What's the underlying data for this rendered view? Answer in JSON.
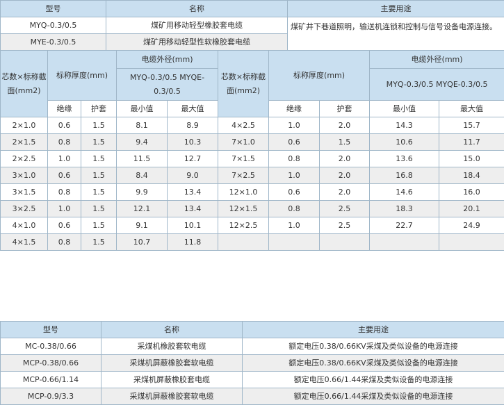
{
  "table1": {
    "headers": [
      "型号",
      "名称",
      "主要用途"
    ],
    "rows": [
      {
        "model": "MYQ-0.3/0.5",
        "name": "煤矿用移动轻型橡胶套电缆"
      },
      {
        "model": "MYE-0.3/0.5",
        "name": "煤矿用移动轻型性软橡胶套电缆"
      }
    ],
    "usage": "煤矿井下巷道照明，输送机连锁和控制与信号设备电源连接。"
  },
  "table2": {
    "h_core": "芯数×标称截面(mm2)",
    "h_core_b": "芯数×标称截面(mm2)",
    "h_thick": "标称厚度(mm)",
    "h_od": "电缆外径(mm)",
    "h_od_sub": "MYQ-0.3/0.5 MYQE-0.3/0.5",
    "h_od_sub_b": "MYQ-0.3/0.5 MYQE-0.3/0.5",
    "h_ins": "绝缘",
    "h_sheath": "护套",
    "h_min": "最小值",
    "h_max": "最大值",
    "left_rows": [
      [
        "2×1.0",
        "0.6",
        "1.5",
        "8.1",
        "8.9"
      ],
      [
        "2×1.5",
        "0.8",
        "1.5",
        "9.4",
        "10.3"
      ],
      [
        "2×2.5",
        "1.0",
        "1.5",
        "11.5",
        "12.7"
      ],
      [
        "3×1.0",
        "0.6",
        "1.5",
        "8.4",
        "9.0"
      ],
      [
        "3×1.5",
        "0.8",
        "1.5",
        "9.9",
        "13.4"
      ],
      [
        "3×2.5",
        "1.0",
        "1.5",
        "12.1",
        "13.4"
      ],
      [
        "4×1.0",
        "0.6",
        "1.5",
        "9.1",
        "10.1"
      ],
      [
        "4×1.5",
        "0.8",
        "1.5",
        "10.7",
        "11.8"
      ]
    ],
    "right_rows": [
      [
        "4×2.5",
        "1.0",
        "2.0",
        "14.3",
        "15.7"
      ],
      [
        "7×1.0",
        "0.6",
        "1.5",
        "10.6",
        "11.7"
      ],
      [
        "7×1.5",
        "0.8",
        "2.0",
        "13.6",
        "15.0"
      ],
      [
        "7×2.5",
        "1.0",
        "2.0",
        "16.8",
        "18.4"
      ],
      [
        "12×1.0",
        "0.6",
        "2.0",
        "14.6",
        "16.0"
      ],
      [
        "12×1.5",
        "0.8",
        "2.5",
        "18.3",
        "20.1"
      ],
      [
        "12×2.5",
        "1.0",
        "2.5",
        "22.7",
        "24.9"
      ],
      [
        "",
        "",
        "",
        "",
        ""
      ]
    ]
  },
  "table3": {
    "headers": [
      "型号",
      "名称",
      "主要用途"
    ],
    "rows": [
      [
        "MC-0.38/0.66",
        "采煤机橡胶套软电缆",
        "额定电压0.38/0.66KV采煤及类似设备的电源连接"
      ],
      [
        "MCP-0.38/0.66",
        "采煤机屏蔽橡胶套软电缆",
        "额定电压0.38/0.66KV采煤及类似设备的电源连接"
      ],
      [
        "MCP-0.66/1.14",
        "采煤机屏蔽橡胶套电缆",
        "额定电压0.66/1.44采煤及类似设备的电源连接"
      ],
      [
        "MCP-0.9/3.3",
        "采煤机屏蔽橡胶套软电缆",
        "额定电压0.66/1.44采煤及类似设备的电源连接"
      ]
    ]
  }
}
